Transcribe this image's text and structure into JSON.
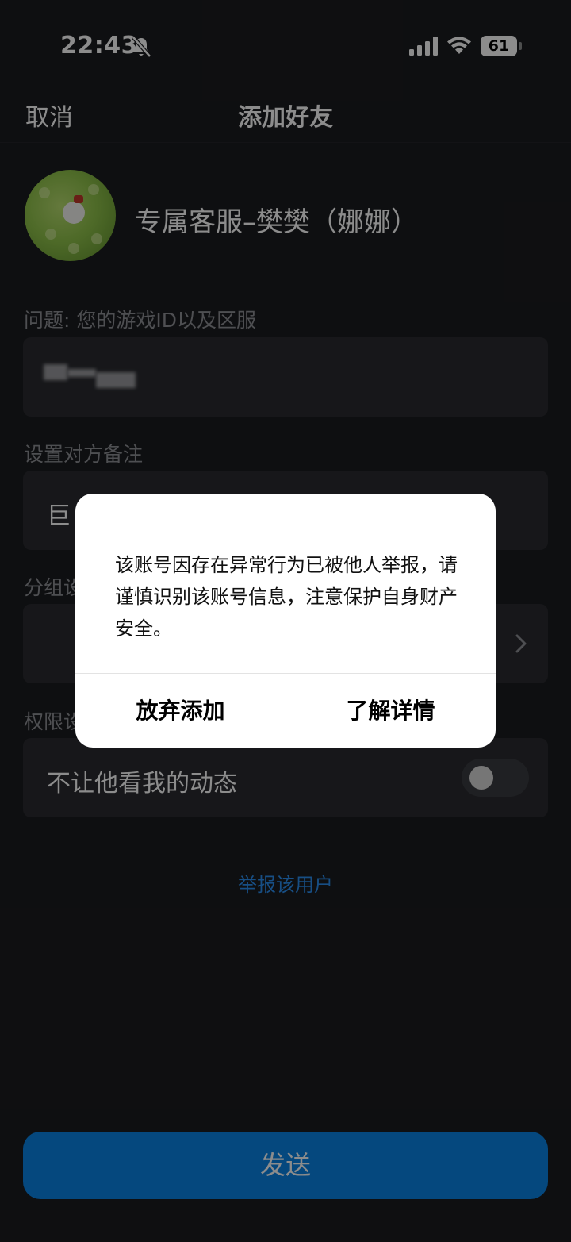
{
  "status_bar": {
    "time": "22:43",
    "battery": "61",
    "icons": [
      "bell-off-icon",
      "signal-icon",
      "wifi-icon",
      "battery-icon"
    ]
  },
  "nav": {
    "cancel_label": "取消",
    "title": "添加好友"
  },
  "profile": {
    "name": "专属客服–樊樊（娜娜）"
  },
  "question": {
    "label": "问题: 您的游戏ID以及区服",
    "value": ""
  },
  "remark": {
    "label": "设置对方备注",
    "value": "巨"
  },
  "group": {
    "label": "分组设"
  },
  "permission": {
    "label": "权限设",
    "toggle_label": "不让他看我的动态",
    "toggle_on": false
  },
  "report_link": "举报该用户",
  "send_label": "发送",
  "dialog": {
    "message": "该账号因存在异常行为已被他人举报，请谨慎识别该账号信息，注意保护自身财产安全。",
    "abandon_label": "放弃添加",
    "details_label": "了解详情"
  },
  "colors": {
    "background": "#1b1c1f",
    "field": "#2a2b30",
    "accent": "#0a84e6",
    "link": "#2b8ff0"
  }
}
